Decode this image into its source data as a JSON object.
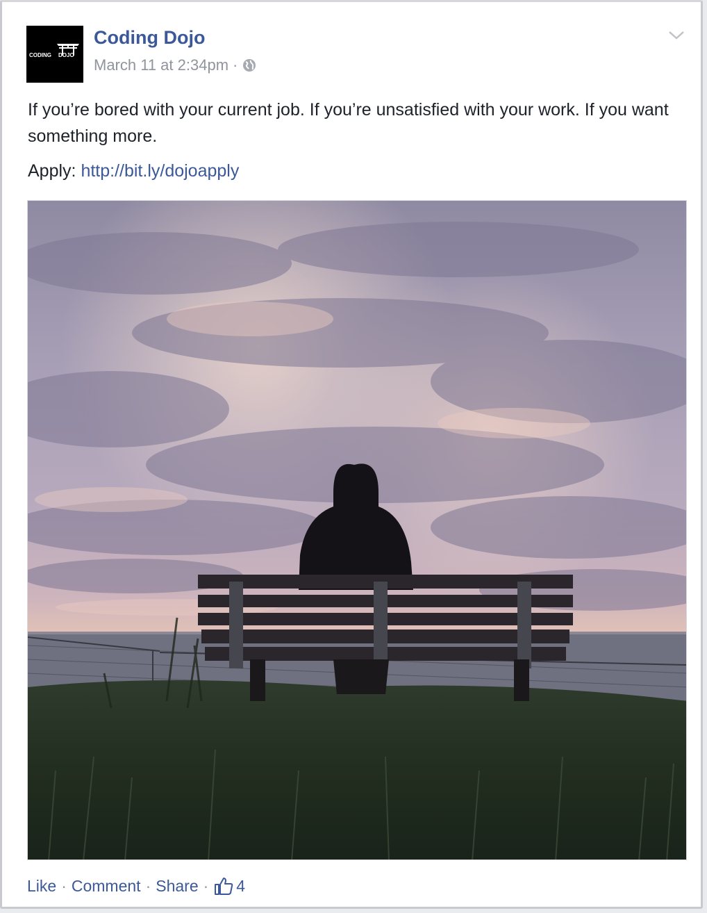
{
  "post": {
    "author": "Coding Dojo",
    "avatar_text": "CODING DOJO",
    "timestamp": "March 11 at 2:34pm",
    "meta_separator": "·",
    "privacy_icon": "globe-icon",
    "menu_icon": "chevron-down-icon",
    "body_text": "If you’re bored with your current job. If you’re unsatisfied with your work. If you want something more.",
    "apply_label": "Apply:",
    "apply_link": "http://bit.ly/dojoapply",
    "image_icon": "photo",
    "accent_color": "#3b5998"
  },
  "actions": {
    "like": "Like",
    "comment": "Comment",
    "share": "Share",
    "separator": "·",
    "like_icon": "thumbs-up-icon",
    "like_count": "4"
  }
}
